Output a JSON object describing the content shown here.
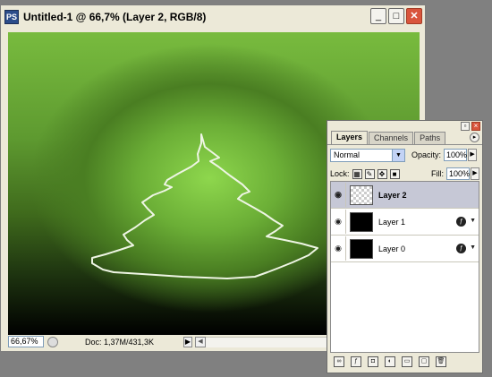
{
  "document": {
    "title": "Untitled-1 @ 66,7% (Layer 2, RGB/8)",
    "app_icon": "PS",
    "window_buttons": {
      "minimize": "_",
      "maximize": "□",
      "close": "✕"
    }
  },
  "status_bar": {
    "zoom": "66,67%",
    "doc_info": "Doc: 1,37M/431,3K"
  },
  "layers_panel": {
    "tabs": [
      {
        "label": "Layers"
      },
      {
        "label": "Channels"
      },
      {
        "label": "Paths"
      }
    ],
    "blend_mode": "Normal",
    "opacity_label": "Opacity:",
    "opacity_value": "100%",
    "lock_label": "Lock:",
    "fill_label": "Fill:",
    "fill_value": "100%",
    "layers": [
      {
        "name": "Layer 2",
        "selected": true,
        "thumbnail": "transparent"
      },
      {
        "name": "Layer 1",
        "selected": false,
        "thumbnail": "black",
        "effects": true
      },
      {
        "name": "Layer 0",
        "selected": false,
        "thumbnail": "black",
        "effects": true
      }
    ]
  },
  "colors": {
    "canvas_glow": "#8ed74d",
    "canvas_dark": "#000000",
    "selected_layer": "#c6c8d6"
  }
}
